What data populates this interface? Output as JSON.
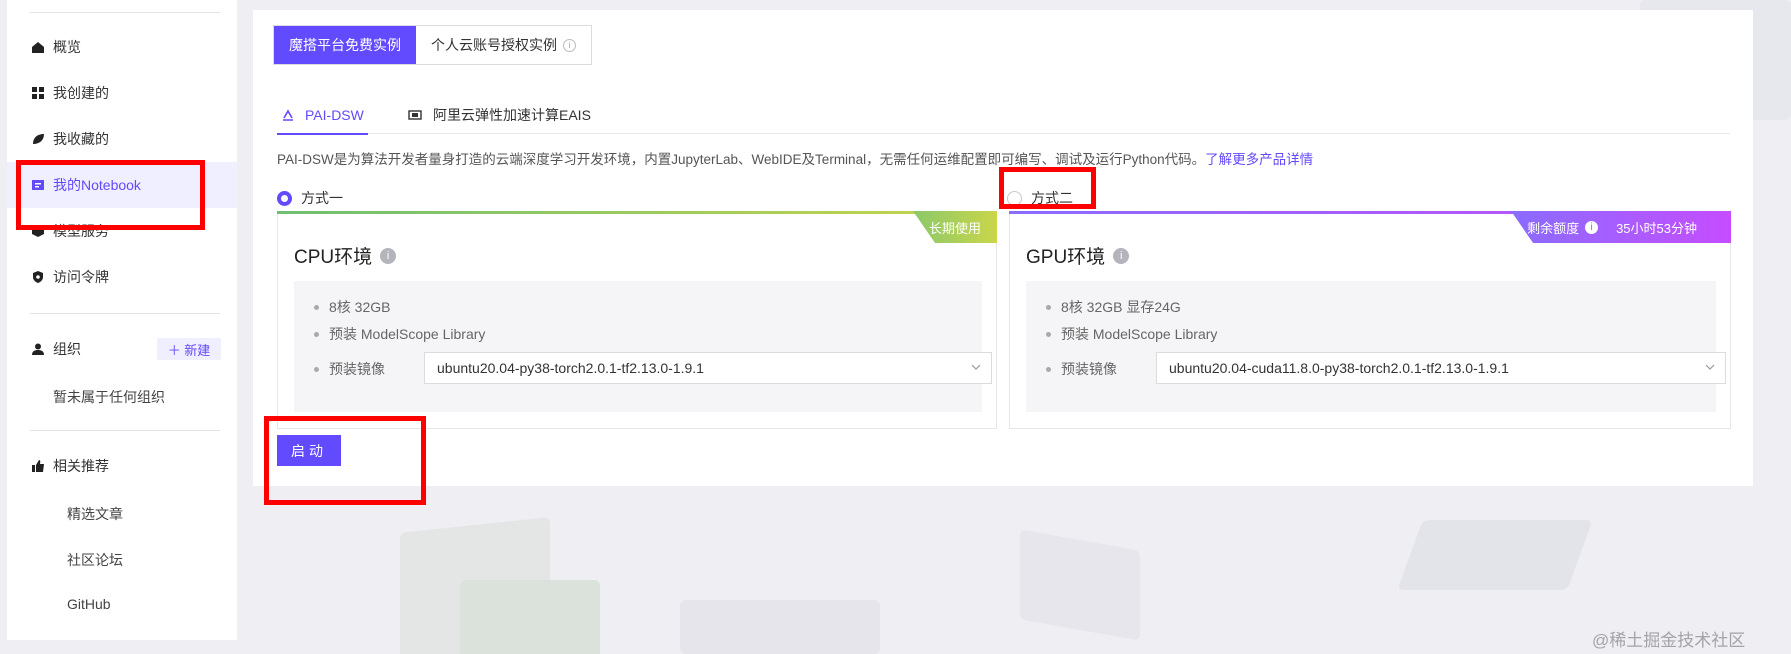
{
  "sidebar": {
    "items": [
      {
        "label": "概览",
        "icon": "home-icon"
      },
      {
        "label": "我创建的",
        "icon": "grid-icon"
      },
      {
        "label": "我收藏的",
        "icon": "leaf-icon"
      },
      {
        "label": "我的Notebook",
        "icon": "notebook-icon",
        "active": true
      },
      {
        "label": "模型服务",
        "icon": "cube-icon"
      },
      {
        "label": "访问令牌",
        "icon": "shield-icon"
      }
    ],
    "org": {
      "label": "组织",
      "new_label": "＋ 新建",
      "empty_text": "暂未属于任何组织"
    },
    "recommend": {
      "label": "相关推荐",
      "links": [
        "精选文章",
        "社区论坛",
        "GitHub"
      ]
    }
  },
  "segment": {
    "free_label": "魔搭平台免费实例",
    "personal_label": "个人云账号授权实例",
    "info_icon": "i"
  },
  "tabs": [
    {
      "label": "PAI-DSW",
      "active": true
    },
    {
      "label": "阿里云弹性加速计算EAIS",
      "active": false
    }
  ],
  "description": {
    "text": "PAI-DSW是为算法开发者量身打造的云端深度学习开发环境，内置JupyterLab、WebIDE及Terminal，无需任何运维配置即可编写、调试及运行Python代码。",
    "link": "了解更多产品详情"
  },
  "options": {
    "one": {
      "label": "方式一",
      "selected": true
    },
    "two": {
      "label": "方式二",
      "selected": false
    }
  },
  "cpu_card": {
    "title": "CPU环境",
    "badge": "长期使用",
    "spec": "8核 32GB",
    "preinstall": "预装 ModelScope Library",
    "image_label": "预装镜像",
    "image_value": "ubuntu20.04-py38-torch2.0.1-tf2.13.0-1.9.1"
  },
  "gpu_card": {
    "title": "GPU环境",
    "badge": "剩余额度",
    "quota": "35小时53分钟",
    "spec": "8核 32GB 显存24G",
    "preinstall": "预装 ModelScope Library",
    "image_label": "预装镜像",
    "image_value": "ubuntu20.04-cuda11.8.0-py38-torch2.0.1-tf2.13.0-1.9.1"
  },
  "start_button": "启动",
  "watermark": "@稀土掘金技术社区",
  "colors": {
    "accent": "#624aff",
    "highlight": "#ff0000",
    "cpu_gradient": [
      "#6fbf73",
      "#c9d64a"
    ],
    "gpu_gradient": [
      "#8a6cff",
      "#c64dff"
    ]
  }
}
